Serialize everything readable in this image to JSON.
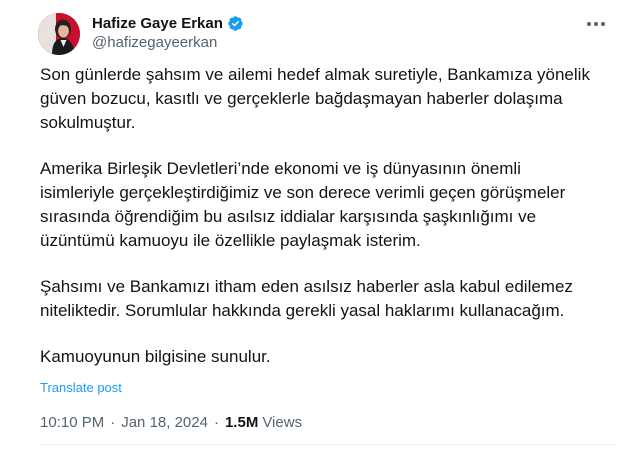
{
  "author": {
    "name": "Hafize Gaye Erkan",
    "handle": "@hafizegayeerkan",
    "verified_icon": "verified-badge-icon",
    "verified_color": "#1d9bf0"
  },
  "tweet": {
    "paragraphs": [
      [
        "Son günlerde şahsım ve ailemi hedef almak suretiyle, Bankamıza yönelik",
        "güven bozucu, kasıtlı ve gerçeklerle bağdaşmayan haberler dolaşıma",
        "sokulmuştur."
      ],
      [
        "Amerika Birleşik Devletleri’nde ekonomi ve iş dünyasının önemli",
        "isimleriyle gerçekleştirdiğimiz ve son derece verimli geçen görüşmeler",
        "sırasında öğrendiğim bu asılsız iddialar karşısında şaşkınlığımı ve",
        "üzüntümü kamuoyu ile özellikle paylaşmak isterim."
      ],
      [
        "Şahsımı ve Bankamızı itham eden asılsız haberler asla kabul edilemez",
        "niteliktedir. Sorumlular hakkında gerekli yasal haklarımı kullanacağım."
      ],
      [
        "Kamuoyunun bilgisine sunulur."
      ]
    ],
    "translate_label": "Translate post",
    "time": "10:10 PM",
    "separator": "·",
    "date": "Jan 18, 2024",
    "views_count": "1.5M",
    "views_label": "Views"
  },
  "icons": {
    "more": "more-options-icon"
  },
  "colors": {
    "text": "#0f1419",
    "secondary": "#536471",
    "link": "#1d9bf0",
    "avatar_bg": "#c8102e"
  }
}
